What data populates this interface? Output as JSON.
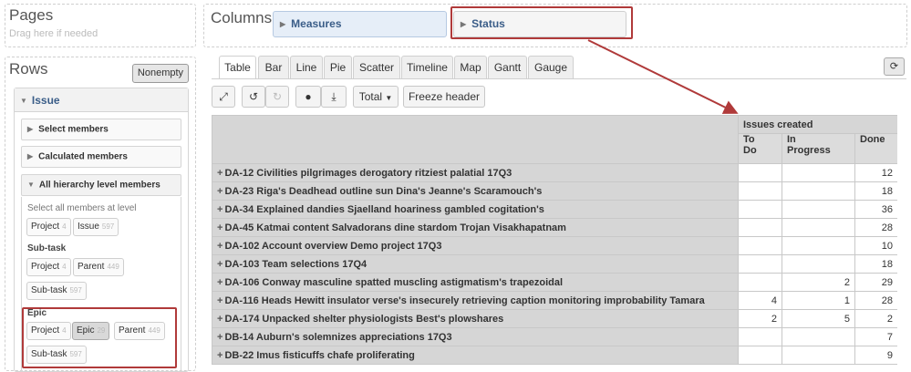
{
  "pages": {
    "title": "Pages",
    "hint": "Drag here if needed"
  },
  "rows": {
    "title": "Rows",
    "nonempty_label": "Nonempty",
    "dimension": "Issue",
    "sections": {
      "select_members": "Select members",
      "calculated_members": "Calculated members",
      "all_levels": "All hierarchy level members"
    },
    "select_all_hint": "Select all members at level",
    "top_chips": [
      {
        "label": "Project",
        "count": "4"
      },
      {
        "label": "Issue",
        "count": "597"
      }
    ],
    "subtask_group": {
      "label": "Sub-task",
      "chips": [
        {
          "label": "Project",
          "count": "4"
        },
        {
          "label": "Parent",
          "count": "449"
        },
        {
          "label": "Sub-task",
          "count": "597"
        }
      ]
    },
    "epic_group": {
      "label": "Epic",
      "chips": [
        {
          "label": "Project",
          "count": "4"
        },
        {
          "label": "Epic",
          "count": "29"
        },
        {
          "label": "Parent",
          "count": "449"
        },
        {
          "label": "Sub-task",
          "count": "597"
        }
      ]
    }
  },
  "columns": {
    "title": "Columns",
    "pills": {
      "measures": "Measures",
      "status": "Status"
    }
  },
  "tabs": [
    "Table",
    "Bar",
    "Line",
    "Pie",
    "Scatter",
    "Timeline",
    "Map",
    "Gantt",
    "Gauge"
  ],
  "active_tab": "Table",
  "toolbar": {
    "total_label": "Total",
    "freeze_label": "Freeze header",
    "icons": [
      "expand-icon",
      "undo-icon",
      "redo-icon",
      "comment-icon",
      "download-icon"
    ]
  },
  "colors": {
    "highlight": "#b03a3a",
    "link": "#3a5d88",
    "header_bg": "#d6d6d6"
  },
  "table": {
    "measure_header": "Issues created",
    "columns": [
      "To\nDo",
      "In\nProgress",
      "Done"
    ],
    "rows": [
      {
        "label": "DA-12 Civilities pilgrimages derogatory ritziest palatial 17Q3",
        "todo": "",
        "inprogress": "",
        "done": "12"
      },
      {
        "label": "DA-23 Riga's Deadhead outline sun Dina's Jeanne's Scaramouch's",
        "todo": "",
        "inprogress": "",
        "done": "18"
      },
      {
        "label": "DA-34 Explained dandies Sjaelland hoariness gambled cogitation's",
        "todo": "",
        "inprogress": "",
        "done": "36"
      },
      {
        "label": "DA-45 Katmai content Salvadorans dine stardom Trojan Visakhapatnam",
        "todo": "",
        "inprogress": "",
        "done": "28"
      },
      {
        "label": "DA-102 Account overview Demo project 17Q3",
        "todo": "",
        "inprogress": "",
        "done": "10"
      },
      {
        "label": "DA-103 Team selections 17Q4",
        "todo": "",
        "inprogress": "",
        "done": "18"
      },
      {
        "label": "DA-106 Conway masculine spatted muscling astigmatism's trapezoidal",
        "todo": "",
        "inprogress": "2",
        "done": "29"
      },
      {
        "label": "DA-116 Heads Hewitt insulator verse's insecurely retrieving caption monitoring improbability Tamara",
        "todo": "4",
        "inprogress": "1",
        "done": "28"
      },
      {
        "label": "DA-174 Unpacked shelter physiologists Best's plowshares",
        "todo": "2",
        "inprogress": "5",
        "done": "2"
      },
      {
        "label": "DB-14 Auburn's solemnizes appreciations 17Q3",
        "todo": "",
        "inprogress": "",
        "done": "7"
      },
      {
        "label": "DB-22 Imus fisticuffs chafe proliferating",
        "todo": "",
        "inprogress": "",
        "done": "9"
      }
    ]
  }
}
